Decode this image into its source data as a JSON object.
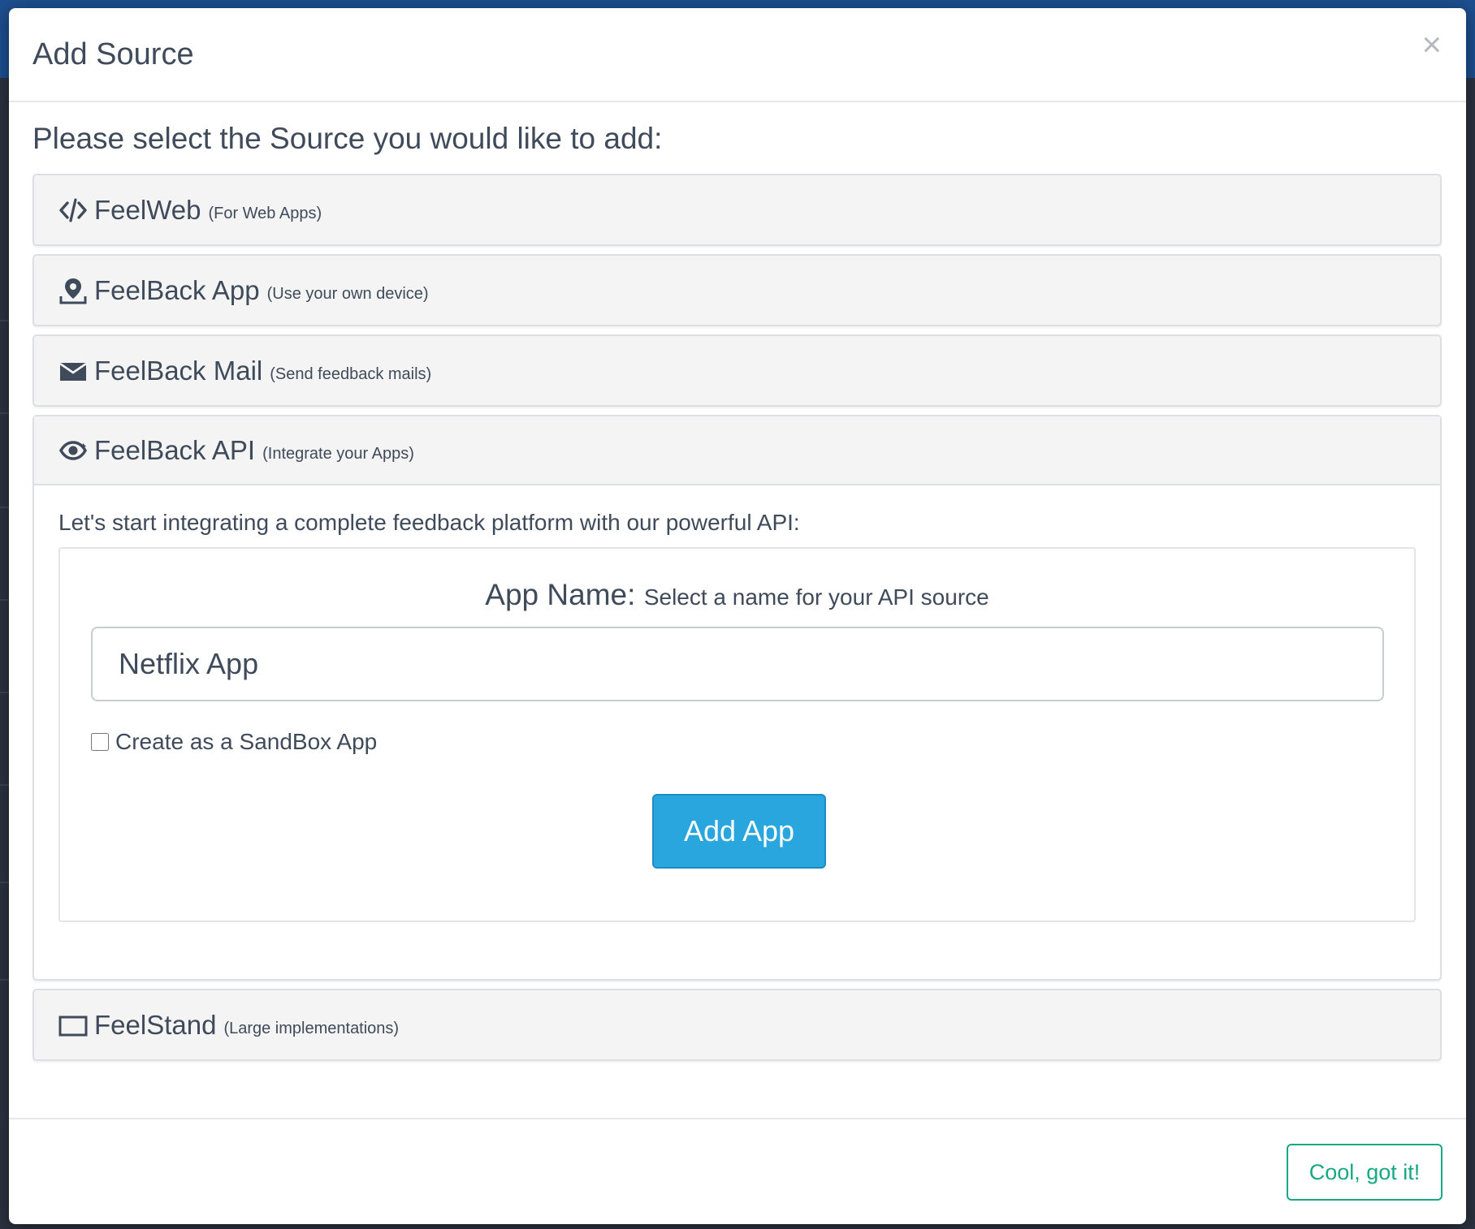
{
  "modal": {
    "title": "Add Source",
    "close_glyph": "×",
    "prompt": "Please select the Source you would like to add:"
  },
  "sources": [
    {
      "title": "FeelWeb",
      "subtitle": "(For Web Apps)",
      "icon": "code-icon"
    },
    {
      "title": "FeelBack App",
      "subtitle": "(Use your own device)",
      "icon": "location-pin-icon"
    },
    {
      "title": "FeelBack Mail",
      "subtitle": "(Send feedback mails)",
      "icon": "envelope-icon"
    },
    {
      "title": "FeelBack API",
      "subtitle": "(Integrate your Apps)",
      "icon": "eye-refresh-icon"
    },
    {
      "title": "FeelStand",
      "subtitle": "(Large implementations)",
      "icon": "monitor-icon"
    }
  ],
  "api_panel": {
    "intro": "Let's start integrating a complete feedback platform with our powerful API:",
    "app_name_label": "App Name:",
    "app_name_hint": "Select a name for your API source",
    "app_name_value": "Netflix App",
    "sandbox_label": "Create as a SandBox App",
    "sandbox_checked": false,
    "add_button": "Add App"
  },
  "footer": {
    "ok_button": "Cool, got it!"
  },
  "colors": {
    "primary_button": "#2aa6de",
    "success_outline": "#1aa783",
    "text": "#3f4a5a",
    "panel_bg": "#f4f4f4"
  }
}
